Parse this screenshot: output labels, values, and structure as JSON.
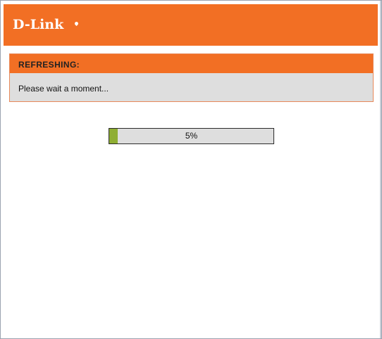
{
  "brand": {
    "logo_text": "D-Link",
    "accent_color": "#f26f24"
  },
  "status_panel": {
    "title": "REFRESHING:",
    "message": "Please wait a moment..."
  },
  "progress": {
    "percent": 5,
    "label": "5%",
    "fill_color": "#8fae33"
  }
}
